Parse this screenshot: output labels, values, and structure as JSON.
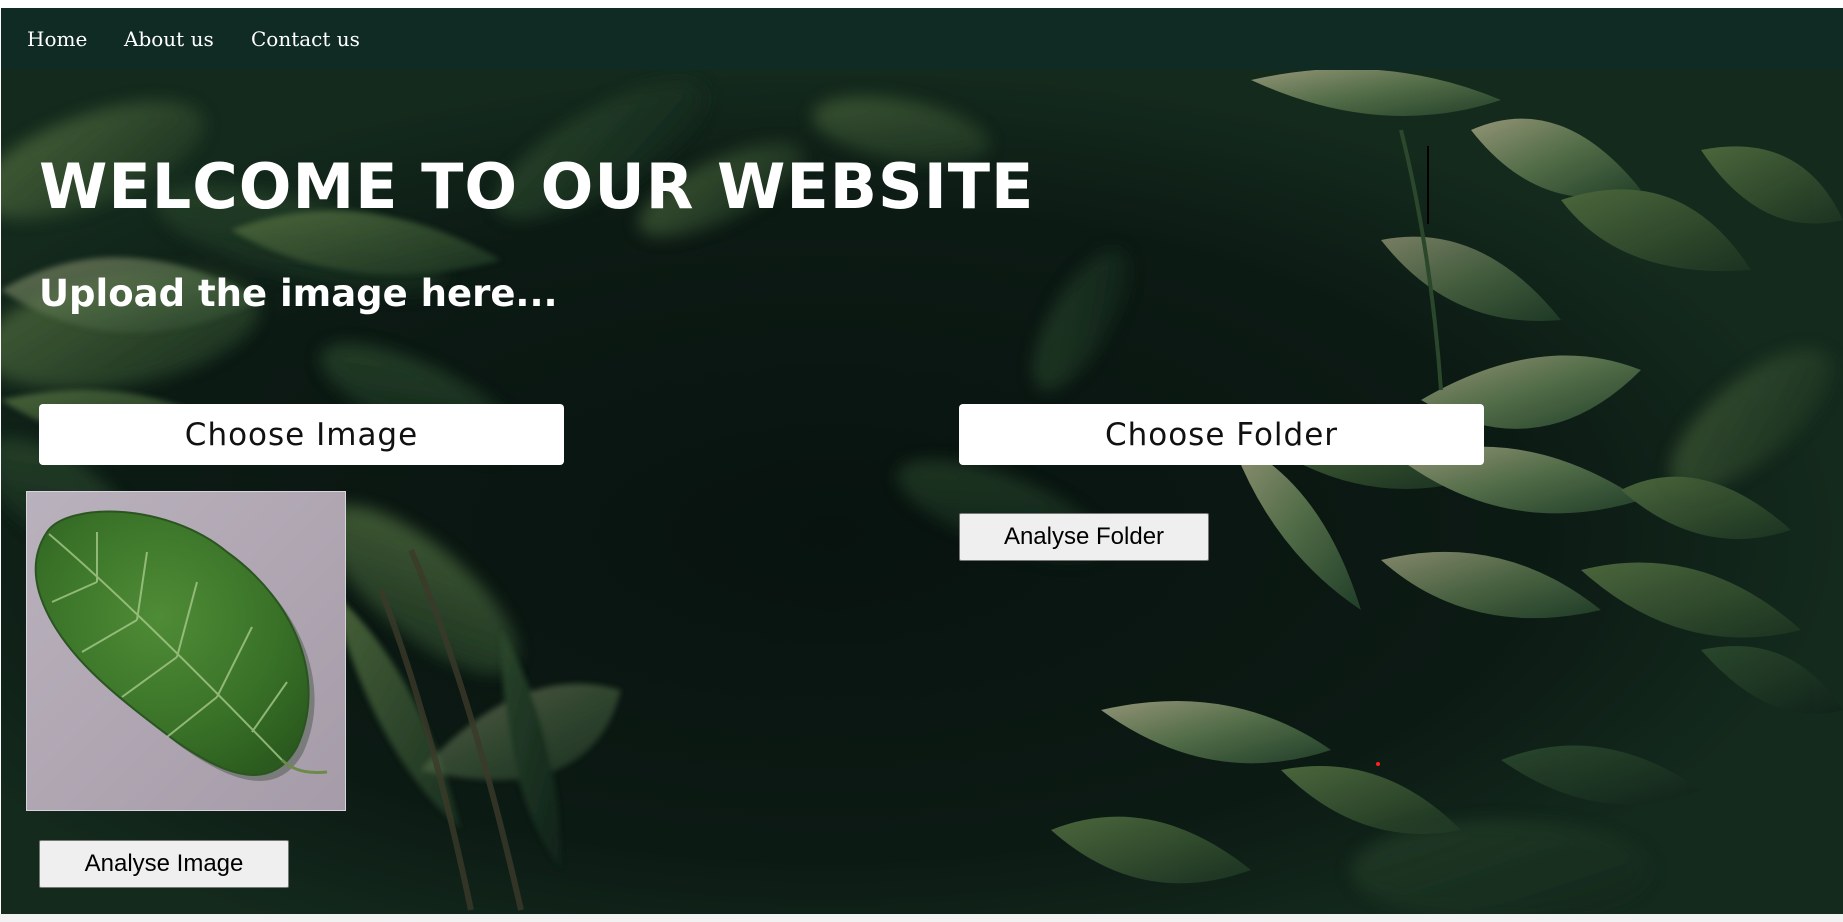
{
  "nav": {
    "items": [
      {
        "label": "Home"
      },
      {
        "label": "About us"
      },
      {
        "label": "Contact us"
      }
    ]
  },
  "hero": {
    "title": "WELCOME TO OUR WEBSITE",
    "subtitle": "Upload the image here..."
  },
  "image_upload": {
    "choose_label": "Choose Image",
    "analyse_label": "Analyse Image"
  },
  "folder_upload": {
    "choose_label": "Choose Folder",
    "analyse_label": "Analyse Folder"
  },
  "colors": {
    "navbar": "#0f2b24",
    "background": "#0b1712",
    "leaf": "#3f7a2c",
    "preview_background": "#b7aeb9"
  }
}
